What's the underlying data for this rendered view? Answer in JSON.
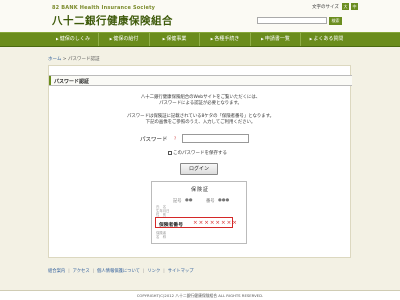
{
  "header": {
    "logo_small": "82 BANK Health Insurance Society",
    "logo_title": "八十二銀行健康保険組合",
    "font_size_label": "文字のサイズ",
    "font_size_large": "大",
    "font_size_medium": "中",
    "search_placeholder": "",
    "search_button": "検索"
  },
  "nav": {
    "items": [
      {
        "label": "健保のしくみ"
      },
      {
        "label": "健保の給付"
      },
      {
        "label": "保健事業"
      },
      {
        "label": "各種手続き"
      },
      {
        "label": "申請書一覧"
      },
      {
        "label": "よくある質問"
      }
    ]
  },
  "breadcrumb": {
    "home": "ホーム",
    "sep": " > ",
    "current": "パスワード認証"
  },
  "main": {
    "title": "パスワード認証",
    "desc1_line1": "八十二銀行健康保険組合のWebサイトをご覧いただくには、",
    "desc1_line2": "パスワードによる認証が必要となります。",
    "desc2_line1": "パスワードは保険証に記載されている8ケタの「保険者番号」となります。",
    "desc2_line2": "下記の画像をご参照のうえ、入力してご利用ください。",
    "password_label": "パスワード",
    "password_help": "?",
    "password_value": "",
    "save_label": "このパスワードを保存する",
    "login_button": "ログイン"
  },
  "card": {
    "title": "保険証",
    "row1_left": "記号",
    "row1_mid": "●●",
    "row1_right": "番号",
    "row1_val": "●●●",
    "small1": "氏　名",
    "small2": "生年月日",
    "small3": "性　別",
    "highlight_label": "保険者番号",
    "highlight_value": "××××××××",
    "small4": "保険者",
    "small5": "名　称"
  },
  "footer": {
    "links": [
      "組合案内",
      "アクセス",
      "個人情報保護について",
      "リンク",
      "サイトマップ"
    ],
    "copyright": "COPYRIGHT(C)2012 八十二銀行健康保険組合 ALL RIGHTS RESERVED."
  },
  "colors": {
    "brand_green": "#6a8c1c",
    "highlight_red": "#d42828"
  }
}
